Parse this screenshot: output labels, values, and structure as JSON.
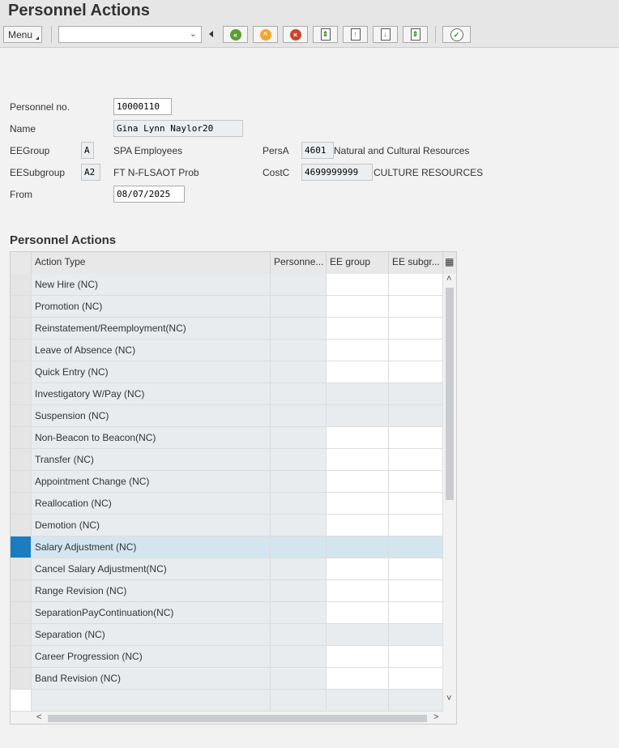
{
  "header": {
    "title": "Personnel Actions",
    "menu_label": "Menu",
    "combo_value": ""
  },
  "toolbar": {
    "icons": [
      "back-icon",
      "exit-icon",
      "cancel-icon",
      "first-page-icon",
      "previous-page-icon",
      "next-page-icon",
      "last-page-icon",
      "execute-icon"
    ]
  },
  "form": {
    "personnel_no_label": "Personnel no.",
    "personnel_no": "10000110",
    "name_label": "Name",
    "name": "Gina Lynn Naylor20",
    "eegroup_label": "EEGroup",
    "eegroup": "A",
    "eegroup_text": "SPA Employees",
    "eesubgroup_label": "EESubgroup",
    "eesubgroup": "A2",
    "eesubgroup_text": "FT N-FLSAOT Prob",
    "from_label": "From",
    "from": "08/07/2025",
    "persa_label": "PersA",
    "persa": "4601",
    "persa_text": "Natural and Cultural Resources",
    "costc_label": "CostC",
    "costc": "4699999999",
    "costc_text": "CULTURE RESOURCES"
  },
  "table": {
    "title": "Personnel Actions",
    "columns": [
      "Action Type",
      "Personne...",
      "EE group",
      "EE subgr..."
    ],
    "rows": [
      {
        "action": "New Hire (NC)"
      },
      {
        "action": "Promotion (NC)"
      },
      {
        "action": "Reinstatement/Reemployment(NC)"
      },
      {
        "action": "Leave of Absence (NC)"
      },
      {
        "action": "Quick Entry (NC)"
      },
      {
        "action": "Investigatory W/Pay (NC)",
        "grey": true
      },
      {
        "action": "Suspension (NC)",
        "grey": true
      },
      {
        "action": "Non-Beacon to Beacon(NC)"
      },
      {
        "action": "Transfer (NC)"
      },
      {
        "action": "Appointment Change (NC)"
      },
      {
        "action": "Reallocation (NC)"
      },
      {
        "action": "Demotion (NC)"
      },
      {
        "action": "Salary Adjustment (NC)",
        "selected": true
      },
      {
        "action": "Cancel Salary Adjustment(NC)"
      },
      {
        "action": "Range Revision (NC)"
      },
      {
        "action": "SeparationPayContinuation(NC)"
      },
      {
        "action": "Separation (NC)",
        "grey": true
      },
      {
        "action": "Career Progression (NC)"
      },
      {
        "action": "Band Revision (NC)"
      }
    ]
  },
  "colors": {
    "selected_row": "#d3e6f0",
    "selected_marker": "#1b7dc0"
  }
}
